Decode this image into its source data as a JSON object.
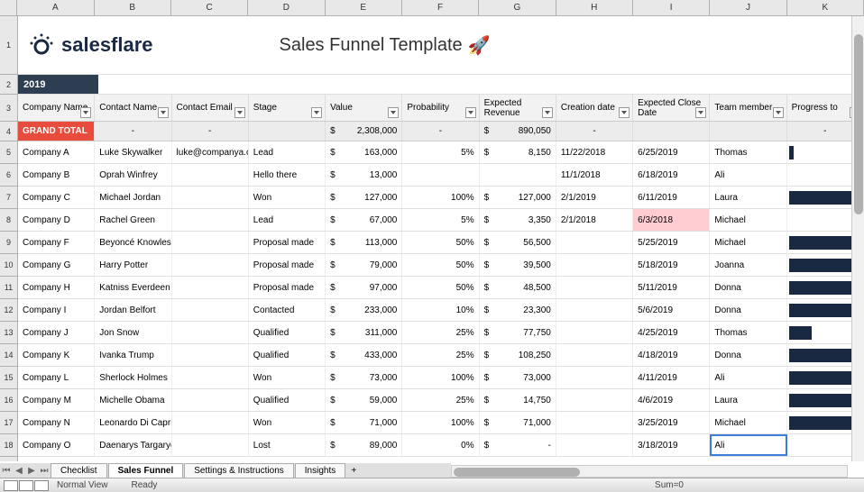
{
  "brand": "salesflare",
  "title": "Sales Funnel Template",
  "rocket": "🚀",
  "year": "2019",
  "col_letters": [
    "A",
    "B",
    "C",
    "D",
    "E",
    "F",
    "G",
    "H",
    "I",
    "J",
    "K"
  ],
  "headers": [
    "Company Name",
    "Contact Name",
    "Contact Email",
    "Stage",
    "Value",
    "Probability",
    "Expected Revenue",
    "Creation date",
    "Expected Close Date",
    "Team member",
    "Progress to"
  ],
  "grand_total": {
    "label": "GRAND TOTAL",
    "value": "2,308,000",
    "expected": "890,050"
  },
  "currency": "$",
  "dash": "-",
  "rows": [
    {
      "company": "Company A",
      "contact": "Luke Skywalker",
      "email": "luke@companya.com",
      "stage": "Lead",
      "value": "163,000",
      "prob": "5%",
      "exp": "8,150",
      "created": "11/22/2018",
      "close": "6/25/2019",
      "member": "Thomas",
      "bar": 6
    },
    {
      "company": "Company B",
      "contact": "Oprah Winfrey",
      "email": "",
      "stage": "Hello there",
      "value": "13,000",
      "prob": "",
      "exp": "",
      "created": "11/1/2018",
      "close": "6/18/2019",
      "member": "Ali",
      "bar": 0
    },
    {
      "company": "Company C",
      "contact": "Michael Jordan",
      "email": "",
      "stage": "Won",
      "value": "127,000",
      "prob": "100%",
      "exp": "127,000",
      "created": "2/1/2019",
      "close": "6/11/2019",
      "member": "Laura",
      "bar": 88
    },
    {
      "company": "Company D",
      "contact": "Rachel Green",
      "email": "",
      "stage": "Lead",
      "value": "67,000",
      "prob": "5%",
      "exp": "3,350",
      "created": "2/1/2018",
      "close": "6/3/2018",
      "close_red": true,
      "member": "Michael",
      "bar": 0
    },
    {
      "company": "Company F",
      "contact": "Beyoncé Knowles",
      "email": "",
      "stage": "Proposal made",
      "value": "113,000",
      "prob": "50%",
      "exp": "56,500",
      "created": "",
      "close": "5/25/2019",
      "member": "Michael",
      "bar": 88
    },
    {
      "company": "Company G",
      "contact": "Harry Potter",
      "email": "",
      "stage": "Proposal made",
      "value": "79,000",
      "prob": "50%",
      "exp": "39,500",
      "created": "",
      "close": "5/18/2019",
      "member": "Joanna",
      "bar": 88
    },
    {
      "company": "Company H",
      "contact": "Katniss Everdeen",
      "email": "",
      "stage": "Proposal made",
      "value": "97,000",
      "prob": "50%",
      "exp": "48,500",
      "created": "",
      "close": "5/11/2019",
      "member": "Donna",
      "bar": 88
    },
    {
      "company": "Company I",
      "contact": "Jordan Belfort",
      "email": "",
      "stage": "Contacted",
      "value": "233,000",
      "prob": "10%",
      "exp": "23,300",
      "created": "",
      "close": "5/6/2019",
      "member": "Donna",
      "bar": 88
    },
    {
      "company": "Company J",
      "contact": "Jon Snow",
      "email": "",
      "stage": "Qualified",
      "value": "311,000",
      "prob": "25%",
      "exp": "77,750",
      "created": "",
      "close": "4/25/2019",
      "member": "Thomas",
      "bar": 30
    },
    {
      "company": "Company K",
      "contact": "Ivanka Trump",
      "email": "",
      "stage": "Qualified",
      "value": "433,000",
      "prob": "25%",
      "exp": "108,250",
      "created": "",
      "close": "4/18/2019",
      "member": "Donna",
      "bar": 88
    },
    {
      "company": "Company L",
      "contact": "Sherlock Holmes",
      "email": "",
      "stage": "Won",
      "value": "73,000",
      "prob": "100%",
      "exp": "73,000",
      "created": "",
      "close": "4/11/2019",
      "member": "Ali",
      "bar": 88
    },
    {
      "company": "Company M",
      "contact": "Michelle Obama",
      "email": "",
      "stage": "Qualified",
      "value": "59,000",
      "prob": "25%",
      "exp": "14,750",
      "created": "",
      "close": "4/6/2019",
      "member": "Laura",
      "bar": 88
    },
    {
      "company": "Company N",
      "contact": "Leonardo Di Caprio",
      "email": "",
      "stage": "Won",
      "value": "71,000",
      "prob": "100%",
      "exp": "71,000",
      "created": "",
      "close": "3/25/2019",
      "member": "Michael",
      "bar": 88
    },
    {
      "company": "Company O",
      "contact": "Daenarys Targaryen",
      "email": "",
      "stage": "Lost",
      "value": "89,000",
      "prob": "0%",
      "exp": "-",
      "exp_dash": true,
      "created": "",
      "close": "3/18/2019",
      "member": "Ali",
      "selected": true,
      "bar": 0
    }
  ],
  "tabs": {
    "items": [
      "Checklist",
      "Sales Funnel",
      "Settings & Instructions",
      "Insights"
    ],
    "active": 1,
    "add": "+"
  },
  "status": {
    "view": "Normal View",
    "ready": "Ready",
    "sum": "Sum=0"
  }
}
